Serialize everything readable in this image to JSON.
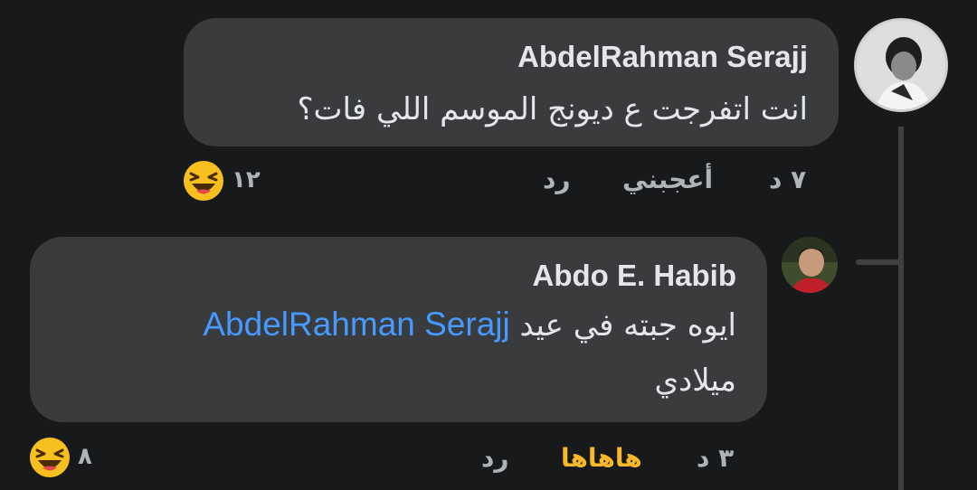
{
  "comment1": {
    "author": "AbdelRahman Serajj",
    "text": "انت اتفرجت ع ديونج الموسم اللي فات؟",
    "time": "٧ د",
    "like_label": "أعجبني",
    "reply_label": "رد",
    "reaction_count": "١٢",
    "reaction_icon": "laughing-emoji-icon"
  },
  "comment2": {
    "author": "Abdo E. Habib",
    "text_line1": "ايوه جبته في عيد",
    "mention": "AbdelRahman Serajj",
    "text_line2": "ميلادي",
    "time": "٣ د",
    "reaction_label": "هاهاها",
    "reply_label": "رد",
    "reaction_count": "٨",
    "reaction_icon": "laughing-emoji-icon"
  },
  "colors": {
    "background": "#18191a",
    "bubble": "#3a3b3c",
    "mention": "#4599ff",
    "haha": "#f7b928",
    "meta": "#b0b3b8"
  }
}
